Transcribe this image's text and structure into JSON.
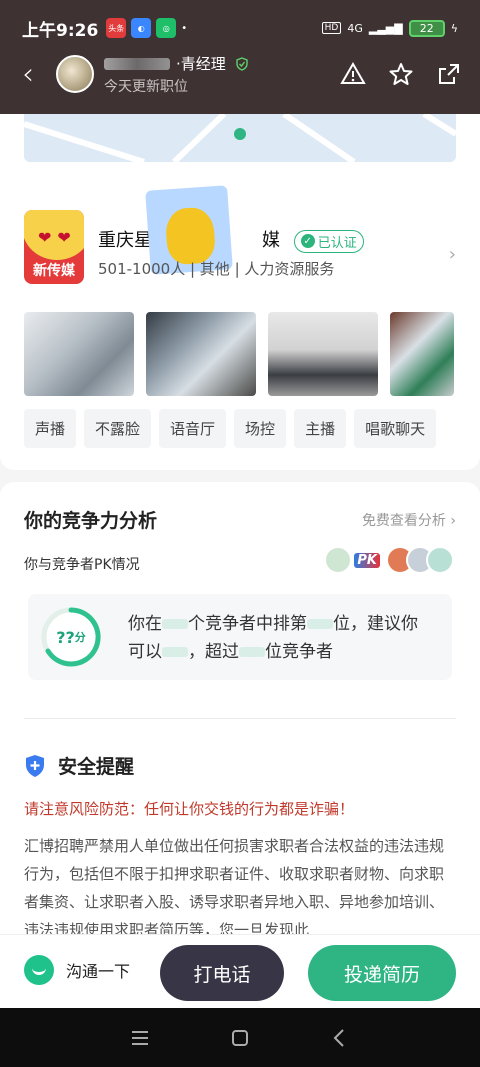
{
  "status_bar": {
    "time": "上午9:26",
    "app_badge_1": "头条",
    "network": "4G",
    "battery": "22"
  },
  "nav": {
    "recruiter_name": "·青经理",
    "recruiter_subtitle": "今天更新职位"
  },
  "company": {
    "logo_text": "新传媒",
    "name_prefix": "重庆星",
    "name_suffix": "媒",
    "verified_label": "已认证",
    "meta": "501-1000人 | 其他 | 人力资源服务",
    "tags": [
      "声播",
      "不露脸",
      "语音厅",
      "场控",
      "主播",
      "唱歌聊天"
    ]
  },
  "competitiveness": {
    "title": "你的竞争力分析",
    "link": "免费查看分析",
    "pk_label": "你与竞争者PK情况",
    "pk_badge": "PK",
    "score": "??",
    "score_unit": "分",
    "line1_a": "你在",
    "line1_b": "个竞争者中排第",
    "line1_c": "位，建议你",
    "line2_a": "可以",
    "line2_b": "，超过",
    "line2_c": "位竞争者"
  },
  "safety": {
    "title": "安全提醒",
    "warning": "请注意风险防范：任何让你交钱的行为都是诈骗！",
    "body": "汇博招聘严禁用人单位做出任何损害求职者合法权益的违法违规行为，包括但不限于扣押求职者证件、收取求职者财物、向求职者集资、让求职者入股、诱导求职者异地入职、异地参加培训、违法违规使用求职者简历等，您一旦发现此"
  },
  "bottom_bar": {
    "chat_label": "沟通一下",
    "call_label": "打电话",
    "apply_label": "投递简历"
  },
  "colors": {
    "header_bg": "#3e3233",
    "accent_green": "#2fb583",
    "call_button": "#383646",
    "warning_red": "#c0392b"
  }
}
